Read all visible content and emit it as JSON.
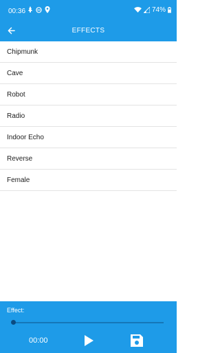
{
  "status_bar": {
    "time": "00:36",
    "battery": "74%",
    "left_icons": [
      "notification-icon",
      "do-not-disturb-icon",
      "location-icon"
    ],
    "right_icons": [
      "wifi-icon",
      "signal-icon",
      "battery-icon"
    ]
  },
  "toolbar": {
    "title": "EFFECTS",
    "back_icon": "back-arrow-icon"
  },
  "effects": [
    {
      "label": "Chipmunk"
    },
    {
      "label": "Cave"
    },
    {
      "label": "Robot"
    },
    {
      "label": "Radio"
    },
    {
      "label": "Indoor Echo"
    },
    {
      "label": "Reverse"
    },
    {
      "label": "Female"
    }
  ],
  "player": {
    "effect_label": "Effect:",
    "time": "00:00",
    "progress": 0,
    "play_icon": "play-icon",
    "save_icon": "save-icon"
  },
  "colors": {
    "accent": "#1e9be8",
    "seek_thumb": "#0b4b82"
  }
}
